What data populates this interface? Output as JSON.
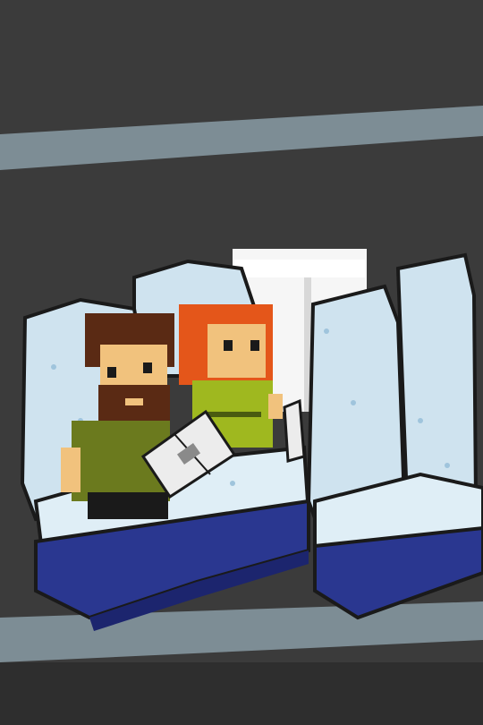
{
  "scene": {
    "setting": "airplane-cabin",
    "characters": [
      {
        "name": "bearded-man",
        "hair": "#5a2a14",
        "shirt": "#6b7a1e",
        "holding": "newspaper"
      },
      {
        "name": "red-haired-woman",
        "hair": "#e4561a",
        "shirt": "#9fb81f",
        "holding": "newspaper"
      }
    ]
  },
  "colors": {
    "background": "#3b3b3b",
    "wall_stripe": "#7d8d95",
    "seat_fabric": "#cfe3ef",
    "seat_shade": "#9fc4dc",
    "seat_outline": "#1a1a1a",
    "seat_base": "#2a3790",
    "seat_base_dark": "#1c256e",
    "window_light": "#f6f6f6",
    "skin": "#f1c27d",
    "newspaper": "#ececec"
  }
}
